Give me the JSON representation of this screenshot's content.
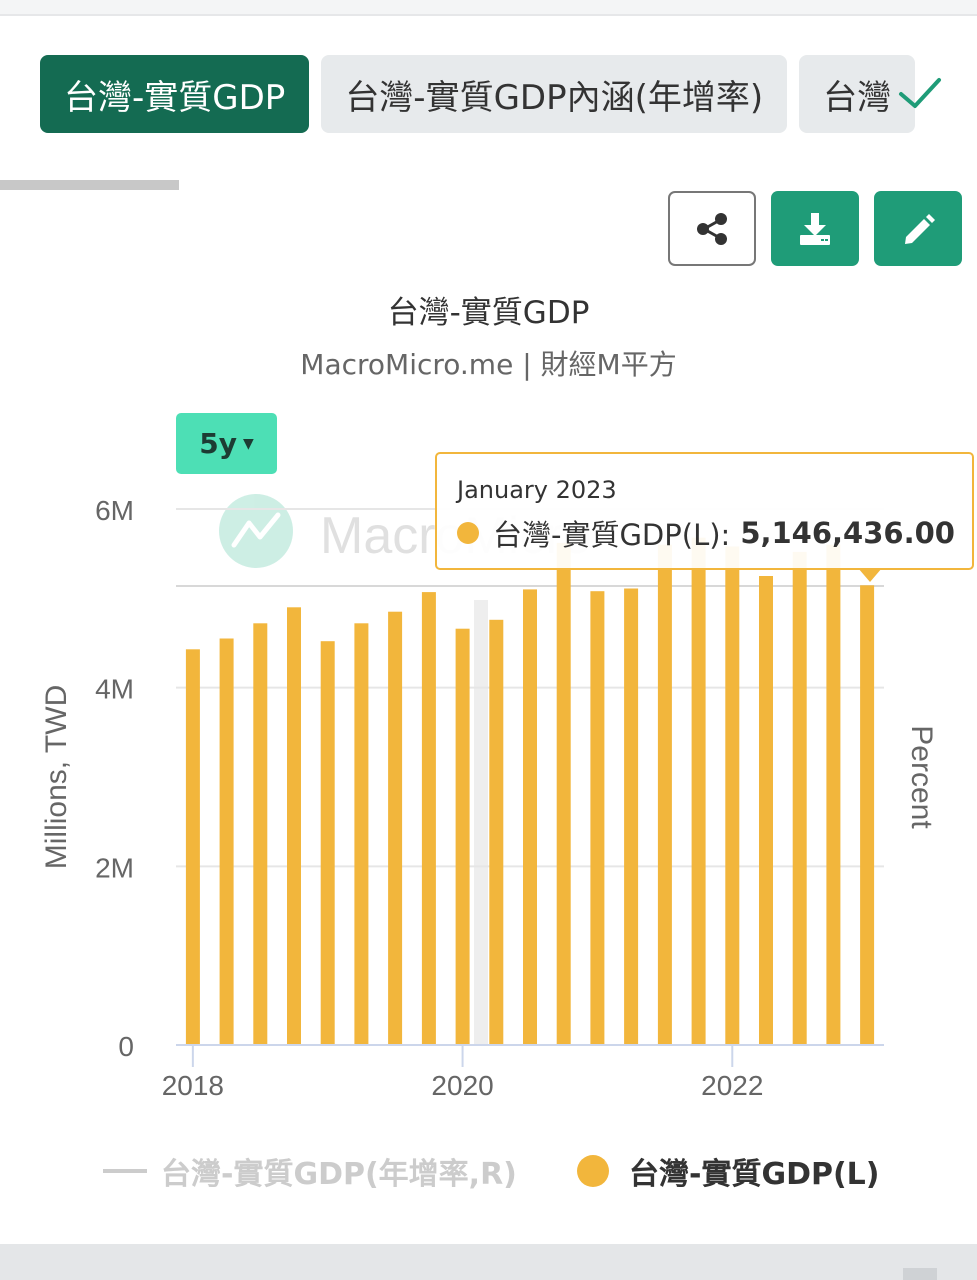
{
  "tabs": [
    {
      "label": "台灣-實質GDP",
      "active": true
    },
    {
      "label": "台灣-實質GDP內涵(年增率)",
      "active": false
    },
    {
      "label": "台灣",
      "active": false
    }
  ],
  "toolbar": {
    "share_icon": "share-icon",
    "download_icon": "download-icon",
    "edit_icon": "pencil-icon"
  },
  "chart_header": {
    "title": "台灣-實質GDP",
    "subtitle": "MacroMicro.me | 財經M平方"
  },
  "range_selector": {
    "label": "5y"
  },
  "watermark": {
    "text": "MacroMicro"
  },
  "tooltip": {
    "date": "January 2023",
    "series_label": "台灣-實質GDP(L):",
    "value": "5,146,436.00"
  },
  "legend": [
    {
      "label": "台灣-實質GDP(年增率,R)",
      "enabled": false
    },
    {
      "label": "台灣-實質GDP(L)",
      "enabled": true
    }
  ],
  "colors": {
    "bar": "#f2b63c",
    "active_tab": "#146b52",
    "action_button": "#1f9c78",
    "range_button": "#4ddfb5",
    "disabled_legend": "#cccccc"
  },
  "chart_data": {
    "type": "bar",
    "title": "台灣-實質GDP",
    "subtitle": "MacroMicro.me | 財經M平方",
    "ylabel_left": "Millions, TWD",
    "ylabel_right": "Percent",
    "yticks": [
      0,
      2000000,
      4000000,
      6000000
    ],
    "ytick_labels": [
      "0",
      "2M",
      "4M",
      "6M"
    ],
    "ylim": [
      0,
      6000000
    ],
    "xtick_labels": [
      "2018",
      "2020",
      "2022"
    ],
    "grid": true,
    "legend_position": "bottom",
    "categories": [
      "2018 Q1",
      "2018 Q2",
      "2018 Q3",
      "2018 Q4",
      "2019 Q1",
      "2019 Q2",
      "2019 Q3",
      "2019 Q4",
      "2020 Q1",
      "2020 Q2",
      "2020 Q3",
      "2020 Q4",
      "2021 Q1",
      "2021 Q2",
      "2021 Q3",
      "2021 Q4",
      "2022 Q1",
      "2022 Q2",
      "2022 Q3",
      "2022 Q4",
      "2023 Q1"
    ],
    "series": [
      {
        "name": "台灣-實質GDP(L)",
        "values": [
          4430000,
          4550000,
          4720000,
          4900000,
          4520000,
          4720000,
          4850000,
          5070000,
          4660000,
          4760000,
          5100000,
          5620000,
          5080000,
          5110000,
          5600000,
          5680000,
          5580000,
          5250000,
          5520000,
          5600000,
          5146436
        ]
      },
      {
        "name": "台灣-實質GDP(年增率,R)",
        "values": [],
        "hidden": true
      }
    ],
    "highlight": {
      "category": "2023 Q1",
      "label": "January 2023",
      "value": 5146436.0
    }
  }
}
